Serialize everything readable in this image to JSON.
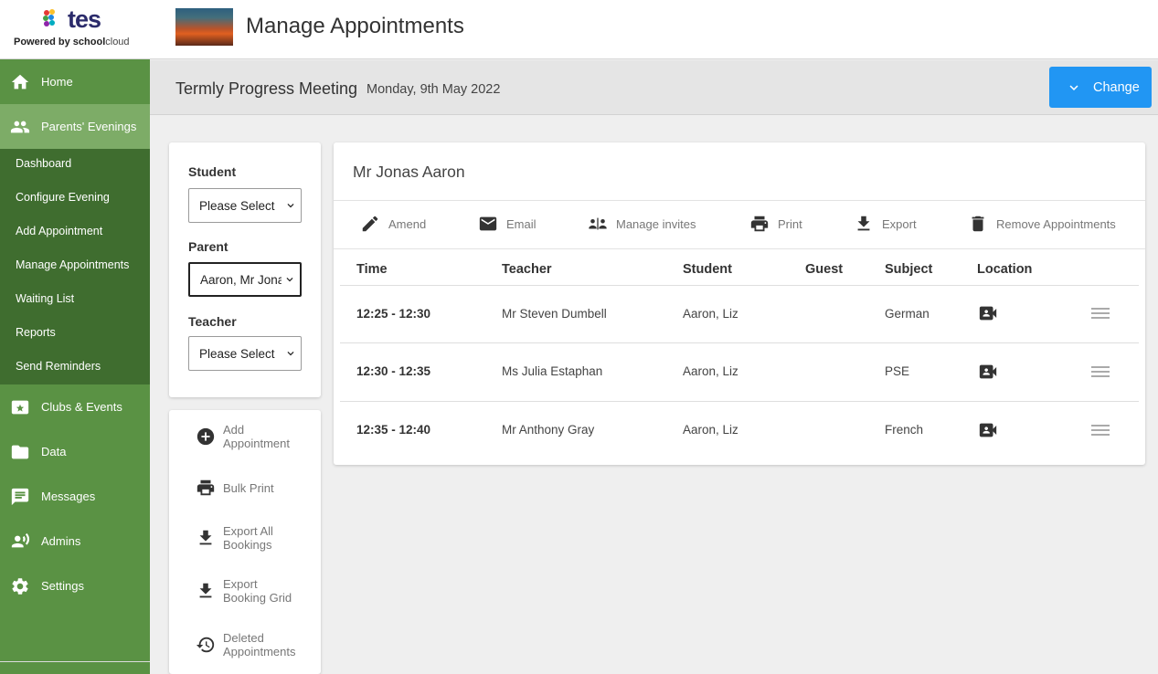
{
  "header": {
    "logo_text": "tes",
    "powered_by": "Powered by ",
    "powered_brand_bold": "school",
    "powered_brand": "cloud",
    "page_title": "Manage Appointments"
  },
  "sidebar": {
    "items": [
      {
        "label": "Home",
        "icon": "home-icon"
      },
      {
        "label": "Parents' Evenings",
        "icon": "people-icon",
        "active": true
      },
      {
        "label": "Clubs & Events",
        "icon": "star-card-icon"
      },
      {
        "label": "Data",
        "icon": "folder-icon"
      },
      {
        "label": "Messages",
        "icon": "message-icon"
      },
      {
        "label": "Admins",
        "icon": "admins-icon"
      },
      {
        "label": "Settings",
        "icon": "gear-icon"
      }
    ],
    "subitems": [
      "Dashboard",
      "Configure Evening",
      "Add Appointment",
      "Manage Appointments",
      "Waiting List",
      "Reports",
      "Send Reminders"
    ]
  },
  "subheader": {
    "meeting_title": "Termly Progress Meeting",
    "meeting_date": "Monday, 9th May 2022",
    "change_label": "Change"
  },
  "filters": {
    "student_label": "Student",
    "student_value": "Please Select",
    "parent_label": "Parent",
    "parent_value": "Aaron, Mr Jonas",
    "teacher_label": "Teacher",
    "teacher_value": "Please Select"
  },
  "actions": {
    "add_appointment": [
      "Add",
      "Appointment"
    ],
    "bulk_print": "Bulk Print",
    "export_all": [
      "Export All",
      "Bookings"
    ],
    "export_grid": [
      "Export",
      "Booking Grid"
    ],
    "deleted": [
      "Deleted",
      "Appointments"
    ]
  },
  "main": {
    "parent_name": "Mr Jonas Aaron",
    "toolbar": {
      "amend": "Amend",
      "email": "Email",
      "manage_invites": "Manage invites",
      "print": "Print",
      "export": "Export",
      "remove": "Remove Appointments"
    },
    "columns": [
      "Time",
      "Teacher",
      "Student",
      "Guest",
      "Subject",
      "Location"
    ],
    "rows": [
      {
        "time": "12:25 - 12:30",
        "teacher": "Mr Steven Dumbell",
        "student": "Aaron, Liz",
        "guest": "",
        "subject": "German",
        "location": "video-call-icon"
      },
      {
        "time": "12:30 - 12:35",
        "teacher": "Ms Julia Estaphan",
        "student": "Aaron, Liz",
        "guest": "",
        "subject": "PSE",
        "location": "video-call-icon"
      },
      {
        "time": "12:35 - 12:40",
        "teacher": "Mr Anthony Gray",
        "student": "Aaron, Liz",
        "guest": "",
        "subject": "French",
        "location": "video-call-icon"
      }
    ]
  },
  "colors": {
    "sidebar": "#5a9244",
    "sidebar_active": "#7dac67",
    "subnav": "#3f6d2f",
    "accent": "#2196f3"
  }
}
